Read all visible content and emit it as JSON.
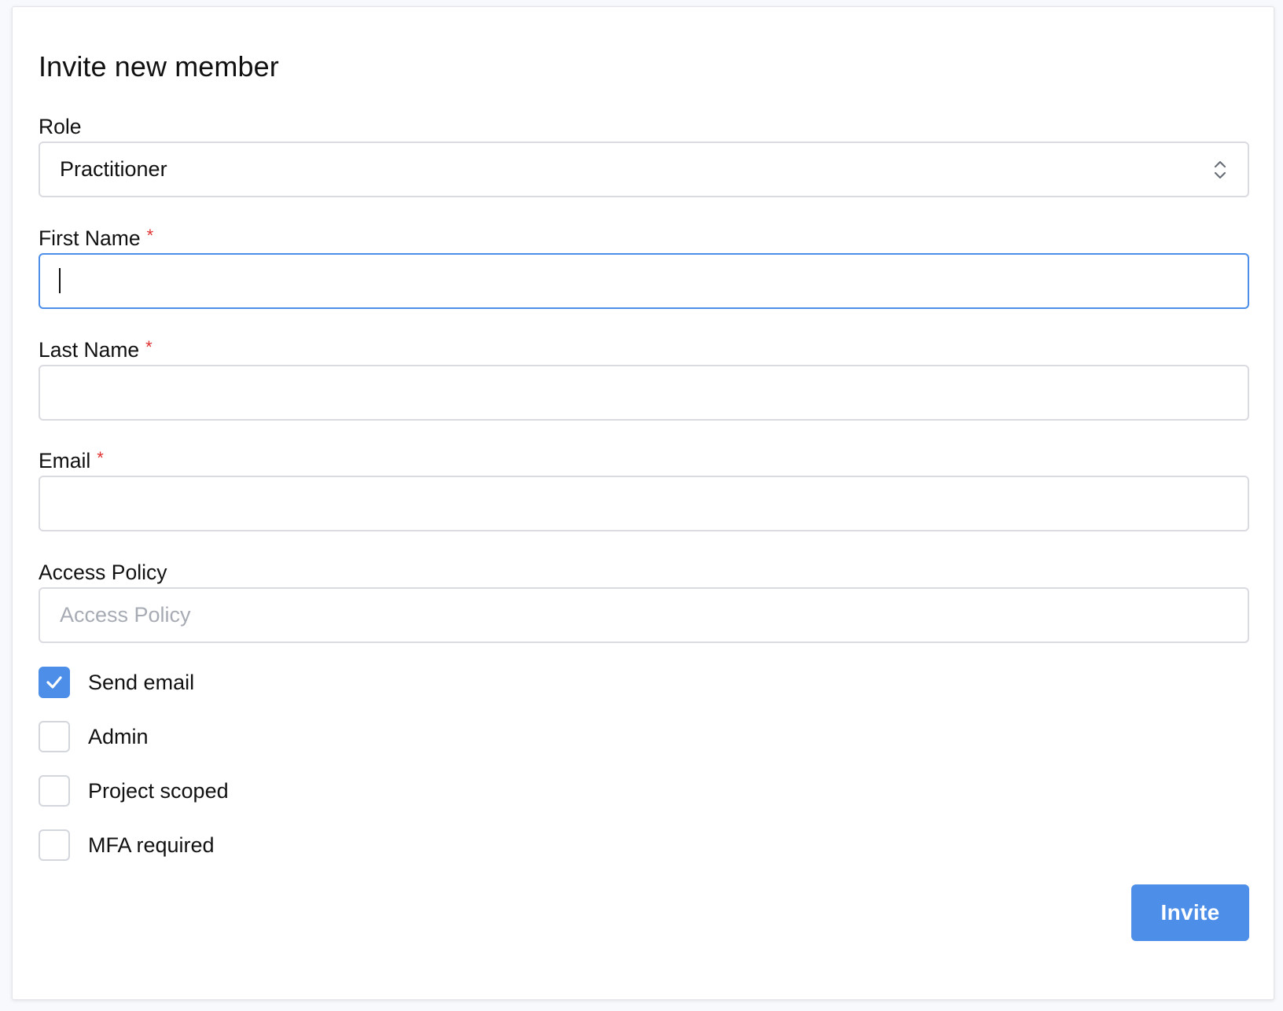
{
  "form": {
    "title": "Invite new member",
    "role": {
      "label": "Role",
      "selected": "Practitioner"
    },
    "first_name": {
      "label": "First Name",
      "required_mark": "*",
      "value": ""
    },
    "last_name": {
      "label": "Last Name",
      "required_mark": "*",
      "value": ""
    },
    "email": {
      "label": "Email",
      "required_mark": "*",
      "value": ""
    },
    "access_policy": {
      "label": "Access Policy",
      "placeholder": "Access Policy",
      "value": ""
    },
    "checkboxes": [
      {
        "label": "Send email",
        "checked": true
      },
      {
        "label": "Admin",
        "checked": false
      },
      {
        "label": "Project scoped",
        "checked": false
      },
      {
        "label": "MFA required",
        "checked": false
      }
    ],
    "submit_label": "Invite"
  },
  "colors": {
    "accent": "#4c8ee8",
    "required": "#e03131",
    "border": "#d9dbe1",
    "page_background": "#f8f9fc"
  },
  "icons": {
    "role_select": "chevron-up-down-icon",
    "checked_box": "checkmark-icon"
  }
}
